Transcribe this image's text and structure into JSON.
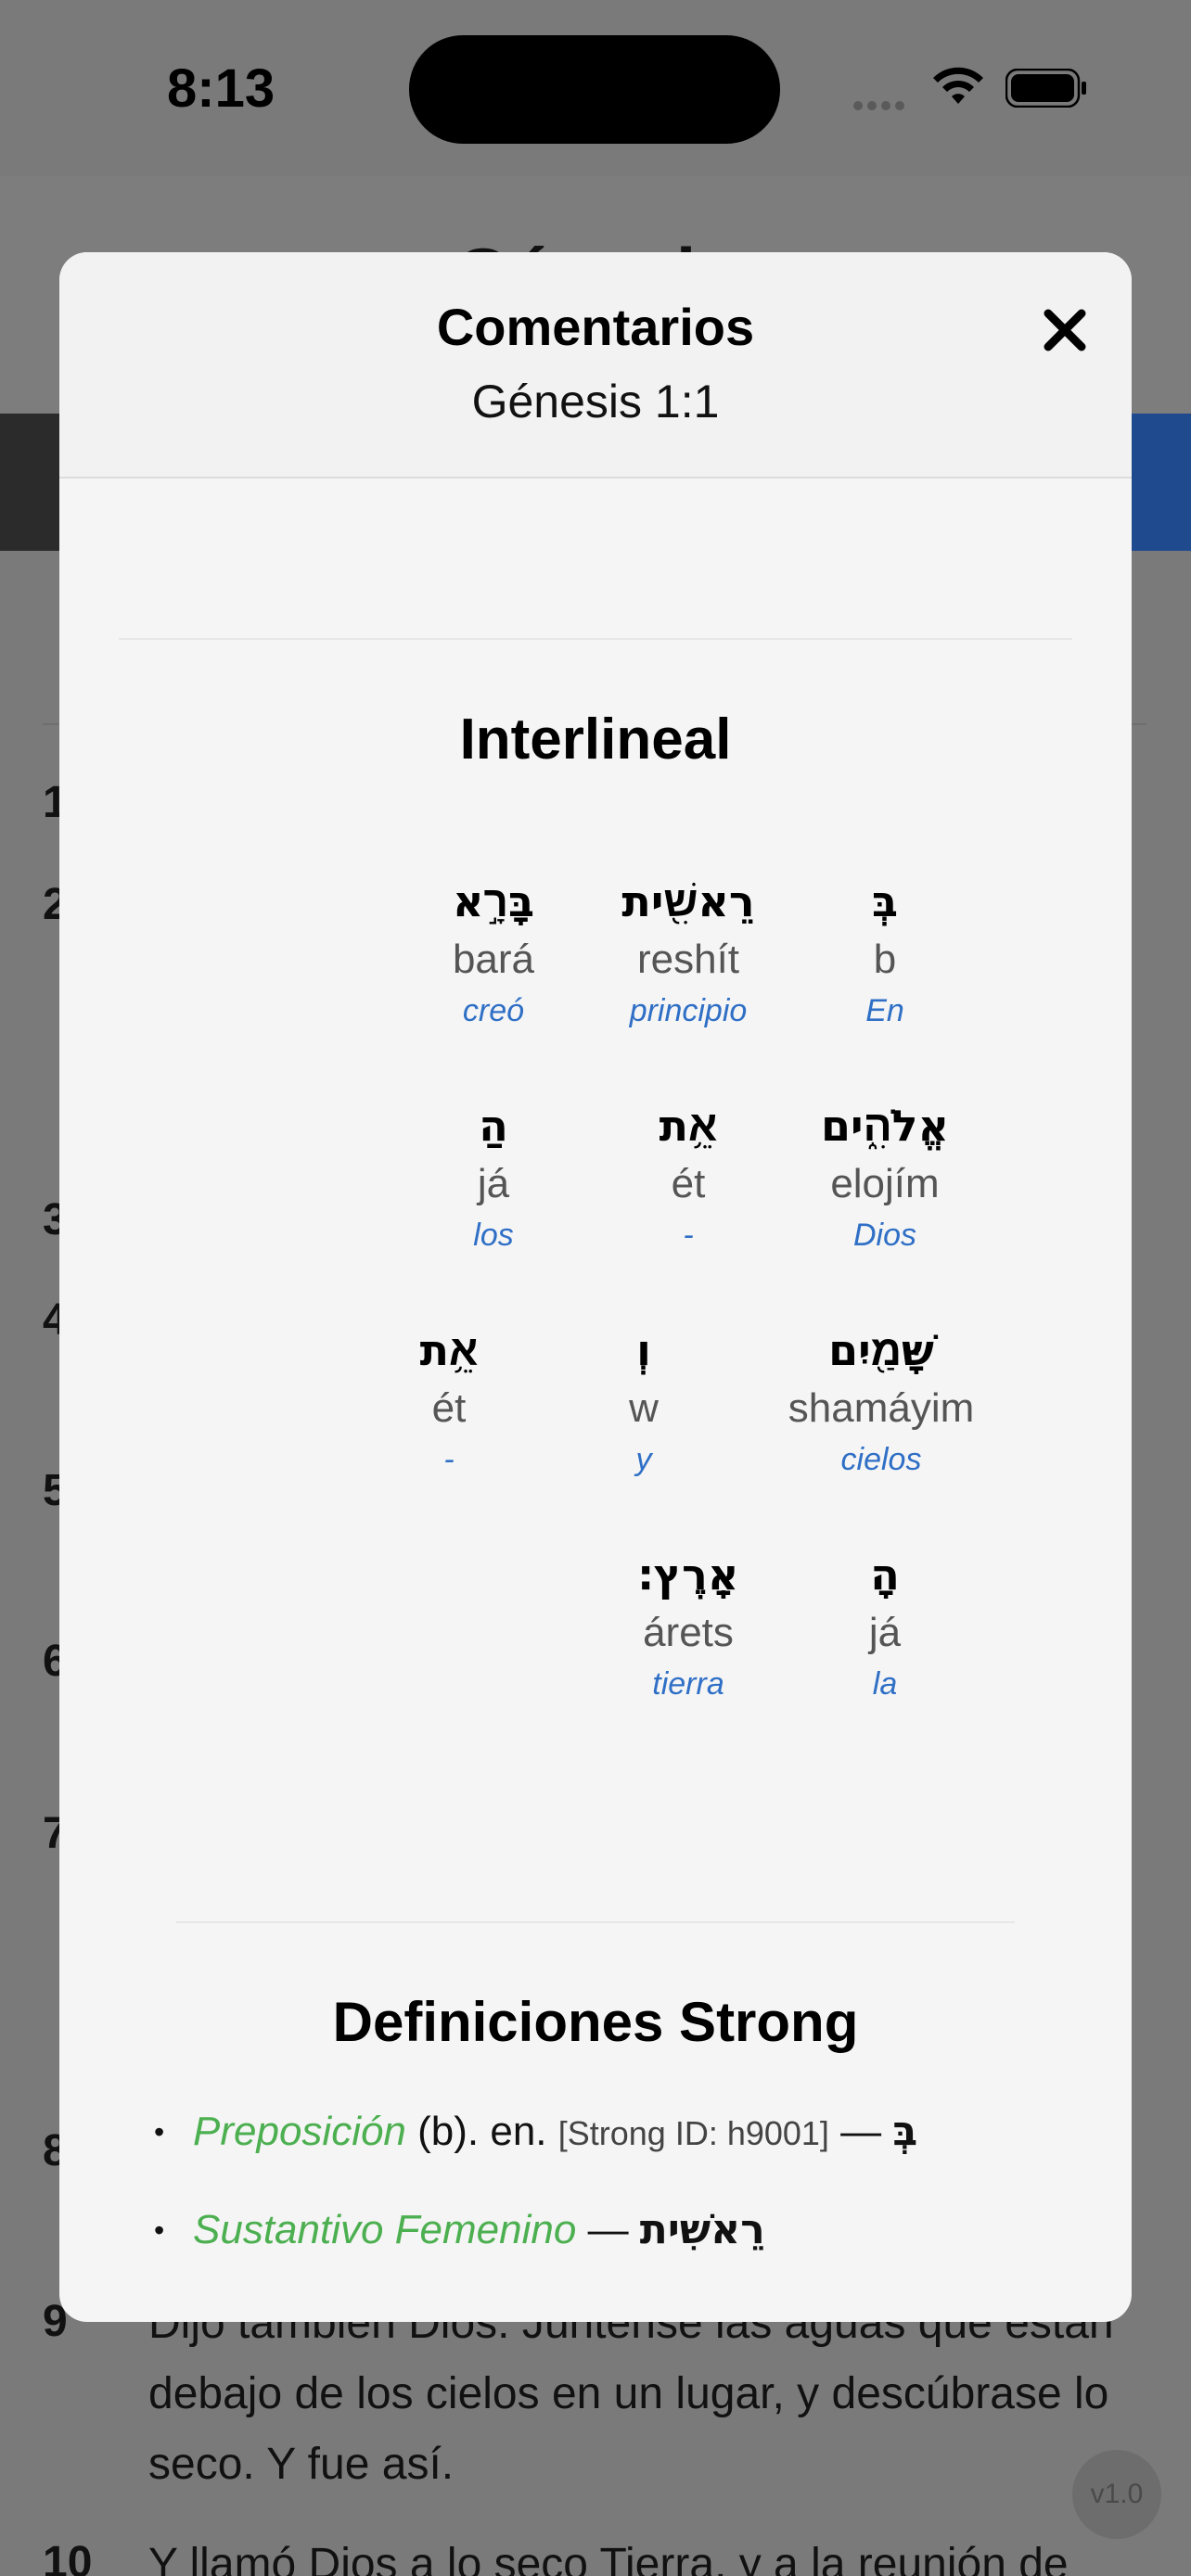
{
  "status_bar": {
    "time": "8:13"
  },
  "background": {
    "title": "Génesis",
    "verses": [
      {
        "num": "1"
      },
      {
        "num": "2"
      },
      {
        "num": "3"
      },
      {
        "num": "4"
      },
      {
        "num": "5"
      },
      {
        "num": "6"
      },
      {
        "num": "7"
      },
      {
        "num": "8"
      },
      {
        "num": "9",
        "text": "Dijo también Dios: Júntense las aguas que están debajo de los cielos en un lugar, y descúbrase lo seco. Y fue así."
      },
      {
        "num": "10",
        "text": "Y llamó Dios a lo seco Tierra, y a la reunión de"
      }
    ],
    "version": "v1.0"
  },
  "modal": {
    "title": "Comentarios",
    "subtitle": "Génesis 1:1",
    "interlinear_title": "Interlineal",
    "words": [
      {
        "heb": "בְּ",
        "translit": "b",
        "gloss": "En"
      },
      {
        "heb": "רֵאשִׁ֖ית",
        "translit": "reshít",
        "gloss": "principio"
      },
      {
        "heb": "בָּרָ֣א",
        "translit": "bará",
        "gloss": "creó"
      },
      {
        "heb": "אֱלֹהִ֑ים",
        "translit": "elojím",
        "gloss": "Dios"
      },
      {
        "heb": "אֵ֥ת",
        "translit": "ét",
        "gloss": "-"
      },
      {
        "heb": "הַ",
        "translit": "já",
        "gloss": "los"
      },
      {
        "heb": "שָּׁמַ֖יִם",
        "translit": "shamáyim",
        "gloss": "cielos"
      },
      {
        "heb": "וְ",
        "translit": "w",
        "gloss": "y"
      },
      {
        "heb": "אֵ֥ת",
        "translit": "ét",
        "gloss": "-"
      },
      {
        "heb": "הָ",
        "translit": "já",
        "gloss": "la"
      },
      {
        "heb": "אָֽרֶץ׃",
        "translit": "árets",
        "gloss": "tierra"
      }
    ],
    "strong_title": "Definiciones Strong",
    "strong": [
      {
        "pos": "Preposición",
        "text": " (b). en. ",
        "id": "[Strong ID: h9001]",
        "dash": " — ",
        "heb": "בְּ"
      },
      {
        "pos": "Sustantivo Femenino",
        "dash": " — ",
        "heb": "רֵאשִׁית"
      }
    ]
  }
}
